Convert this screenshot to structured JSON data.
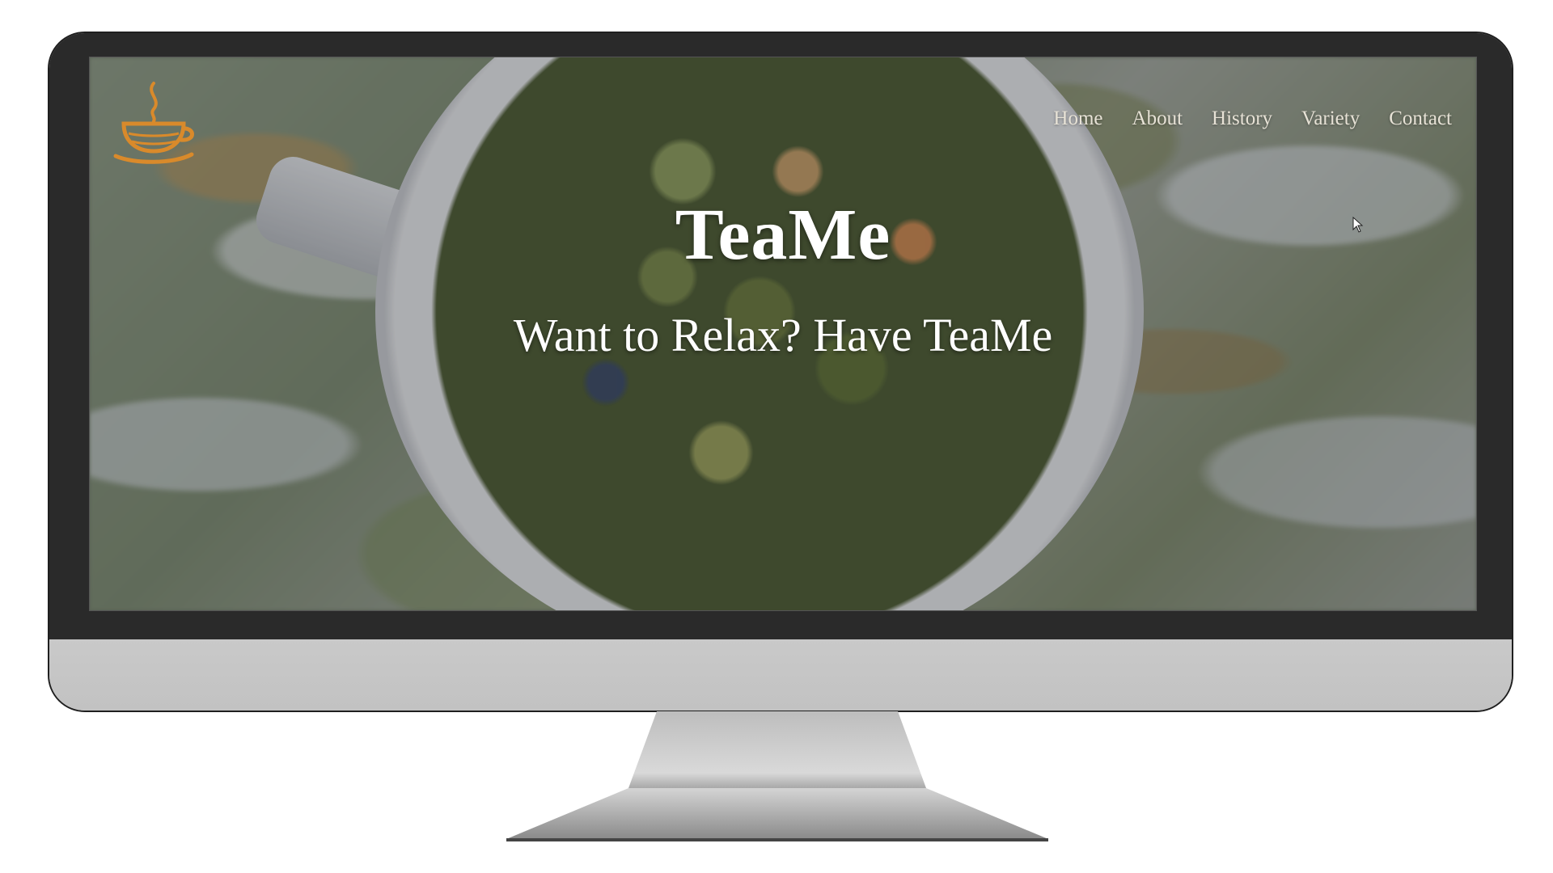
{
  "site": {
    "logo_icon": "tea-cup-steam-icon",
    "nav": [
      "Home",
      "About",
      "History",
      "Variety",
      "Contact"
    ],
    "hero": {
      "title": "TeaMe",
      "subtitle": "Want to Relax? Have TeaMe"
    }
  },
  "colors": {
    "nav_text": "#e7e2d6",
    "hero_text": "#ffffff",
    "logo": "#d98a2b",
    "bezel": "#2a2a2a",
    "chin": "#c9c9c9"
  }
}
